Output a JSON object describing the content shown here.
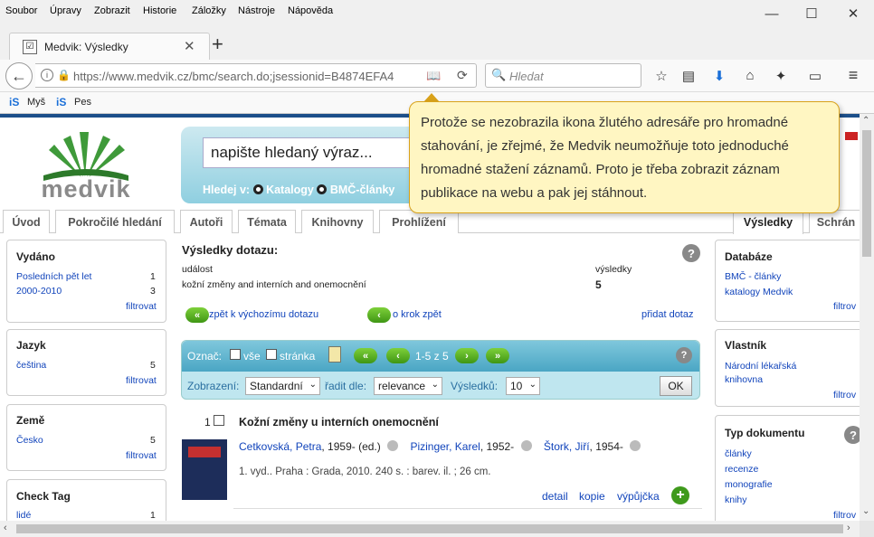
{
  "menu": [
    "Soubor",
    "Úpravy",
    "Zobrazit",
    "Historie",
    "Záložky",
    "Nástroje",
    "Nápověda"
  ],
  "tab": {
    "title": "Medvik: Výsledky"
  },
  "url": "https://www.medvik.cz/bmc/search.do;jsessionid=B4874EFA4",
  "url_domain": "medvik.cz",
  "search_placeholder": "Hledat",
  "bookmarks": [
    "Myš",
    "Pes"
  ],
  "site": {
    "logo": "medvik",
    "query_placeholder": "napište hledaný výraz...",
    "search_in": "Hledej v:",
    "scope1": "Katalogy",
    "scope2": "BMČ-články",
    "tabs": [
      "Úvod",
      "Pokročilé hledání",
      "Autoři",
      "Témata",
      "Knihovny",
      "Prohlížení"
    ],
    "tab_results": "Výsledky",
    "tab_saved": "Schrán"
  },
  "left": {
    "vydano": {
      "title": "Vydáno",
      "items": [
        {
          "label": "Posledních pět let",
          "count": "1"
        },
        {
          "label": "2000-2010",
          "count": "3"
        }
      ],
      "filter": "filtrovat"
    },
    "jazyk": {
      "title": "Jazyk",
      "items": [
        {
          "label": "čeština",
          "count": "5"
        }
      ],
      "filter": "filtrovat"
    },
    "zeme": {
      "title": "Země",
      "items": [
        {
          "label": "Česko",
          "count": "5"
        }
      ],
      "filter": "filtrovat"
    },
    "check": {
      "title": "Check Tag",
      "items": [
        {
          "label": "lidé",
          "count": "1"
        }
      ]
    }
  },
  "results": {
    "title": "Výsledky dotazu:",
    "col_event": "událost",
    "col_results": "výsledky",
    "query": "kožní změny and interních and onemocnění",
    "count": "5",
    "back_start": "zpět k výchozímu dotazu",
    "back_step": "o krok zpět",
    "add_query": "přidat dotaz",
    "mark": "Označ:",
    "all": "vše",
    "page": "stránka",
    "range": "1-5 z 5",
    "display_label": "Zobrazení:",
    "display_value": "Standardní",
    "sort_label": "řadit dle:",
    "sort_value": "relevance",
    "per_page_label": "Výsledků:",
    "per_page_value": "10",
    "ok": "OK"
  },
  "record": {
    "number": "1",
    "title": "Kožní změny u interních onemocnění",
    "author1": "Cetkovská, Petra",
    "author1_extra": ", 1959- (ed.)",
    "author2": "Pizinger, Karel",
    "author2_extra": ", 1952-",
    "author3": "Štork, Jiří",
    "author3_extra": ", 1954-",
    "imprint": "1. vyd.. Praha : Grada, 2010. 240 s. : barev. il. ; 26 cm.",
    "actions": [
      "detail",
      "kopie",
      "výpůjčka"
    ]
  },
  "right": {
    "databaze": {
      "title": "Databáze",
      "items": [
        "BMČ - články",
        "katalogy Medvik"
      ],
      "filter": "filtrov"
    },
    "vlastnik": {
      "title": "Vlastník",
      "items": [
        "Národní lékařská knihovna"
      ],
      "filter": "filtrov"
    },
    "typ": {
      "title": "Typ dokumentu",
      "items": [
        "články",
        "recenze",
        "monografie",
        "knihy"
      ],
      "filter": "filtrov"
    }
  },
  "tooltip": "Protože se nezobrazila ikona žlutého adresáře pro hromadné stahování, je zřejmé, že Medvik neumožňuje toto jednoduché hromadné stažení záznamů. Proto je třeba zobrazit záznam publikace na webu a pak jej stáhnout.",
  "colors": {
    "accent": "#2a72b8",
    "green": "#4fa21d",
    "tooltip_bg": "#fff6c2"
  }
}
